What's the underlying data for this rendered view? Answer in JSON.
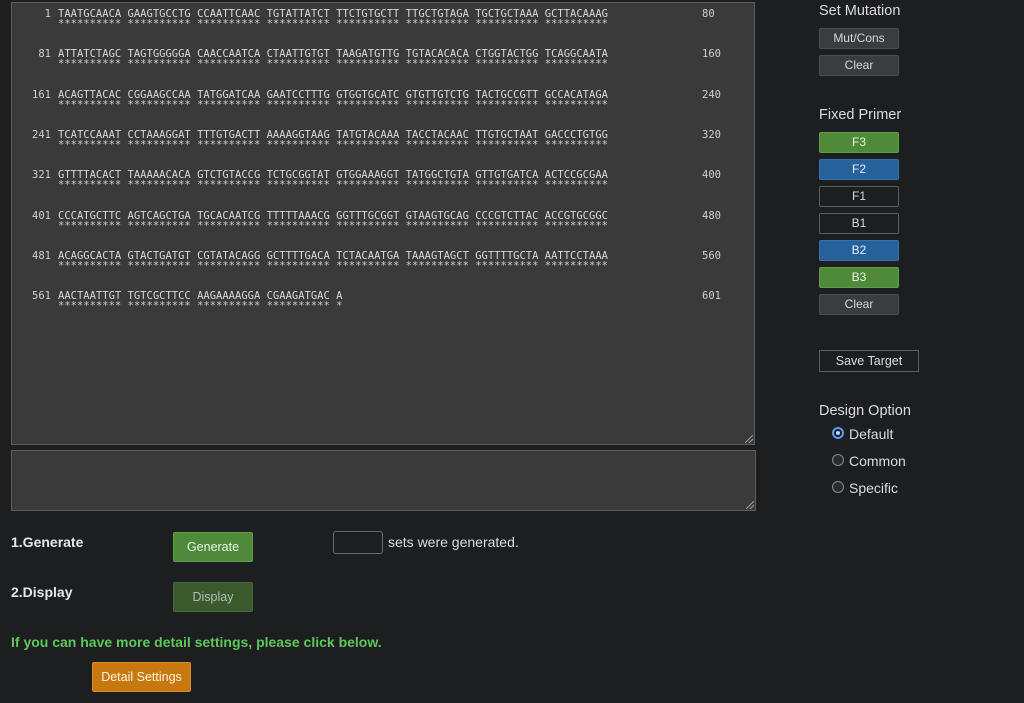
{
  "sequence": {
    "rows": [
      {
        "start": "1",
        "end": "80",
        "seq": "TAATGCAACA GAAGTGCCTG CCAATTCAAC TGTATTATCT TTCTGTGCTT TTGCTGTAGA TGCTGCTAAA GCTTACAAAG",
        "stars": "********** ********** ********** ********** ********** ********** ********** **********"
      },
      {
        "start": "81",
        "end": "160",
        "seq": "ATTATCTAGC TAGTGGGGGA CAACCAATCA CTAATTGTGT TAAGATGTTG TGTACACACA CTGGTACTGG TCAGGCAATA",
        "stars": "********** ********** ********** ********** ********** ********** ********** **********"
      },
      {
        "start": "161",
        "end": "240",
        "seq": "ACAGTTACAC CGGAAGCCAA TATGGATCAA GAATCCTTTG GTGGTGCATC GTGTTGTCTG TACTGCCGTT GCCACATAGA",
        "stars": "********** ********** ********** ********** ********** ********** ********** **********"
      },
      {
        "start": "241",
        "end": "320",
        "seq": "TCATCCAAAT CCTAAAGGAT TTTGTGACTT AAAAGGTAAG TATGTACAAA TACCTACAAC TTGTGCTAAT GACCCTGTGG",
        "stars": "********** ********** ********** ********** ********** ********** ********** **********"
      },
      {
        "start": "321",
        "end": "400",
        "seq": "GTTTTACACT TAAAAACACA GTCTGTACCG TCTGCGGTAT GTGGAAAGGT TATGGCTGTA GTTGTGATCA ACTCCGCGAA",
        "stars": "********** ********** ********** ********** ********** ********** ********** **********"
      },
      {
        "start": "401",
        "end": "480",
        "seq": "CCCATGCTTC AGTCAGCTGA TGCACAATCG TTTTTAAACG GGTTTGCGGT GTAAGTGCAG CCCGTCTTAC ACCGTGCGGC",
        "stars": "********** ********** ********** ********** ********** ********** ********** **********"
      },
      {
        "start": "481",
        "end": "560",
        "seq": "ACAGGCACTA GTACTGATGT CGTATACAGG GCTTTTGACA TCTACAATGA TAAAGTAGCT GGTTTTGCTA AATTCCTAAA",
        "stars": "********** ********** ********** ********** ********** ********** ********** **********"
      },
      {
        "start": "561",
        "end": "601",
        "seq": "AACTAATTGT TGTCGCTTCC AAGAAAAGGA CGAAGATGAC A",
        "stars": "********** ********** ********** ********** *"
      }
    ]
  },
  "steps": {
    "generate_label": "1.Generate",
    "generate_button": "Generate",
    "sets_text": "sets were generated.",
    "display_label": "2.Display",
    "display_button": "Display"
  },
  "detail": {
    "note": "If you can have more detail settings, please click below.",
    "button": "Detail Settings"
  },
  "sidebar": {
    "set_mutation": {
      "title": "Set Mutation",
      "mutcons": "Mut/Cons",
      "clear": "Clear"
    },
    "fixed_primer": {
      "title": "Fixed Primer",
      "items": [
        {
          "label": "F3",
          "style": "green"
        },
        {
          "label": "F2",
          "style": "blue"
        },
        {
          "label": "F1",
          "style": "dark"
        },
        {
          "label": "B1",
          "style": "dark"
        },
        {
          "label": "B2",
          "style": "blue"
        },
        {
          "label": "B3",
          "style": "green"
        }
      ],
      "clear": "Clear"
    },
    "save_target": "Save Target",
    "design_option": {
      "title": "Design Option",
      "options": [
        {
          "label": "Default",
          "checked": true
        },
        {
          "label": "Common",
          "checked": false
        },
        {
          "label": "Specific",
          "checked": false
        }
      ]
    }
  }
}
